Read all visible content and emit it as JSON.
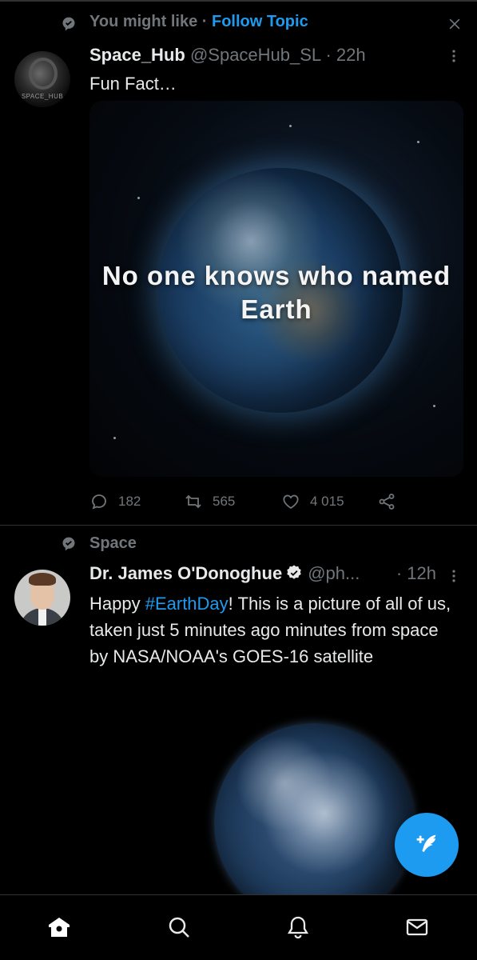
{
  "tweet1": {
    "context_label": "You might like",
    "context_separator": " · ",
    "follow_topic": "Follow Topic",
    "avatar_label": "SPACE_HUB",
    "name": "Space_Hub",
    "handle": "@SpaceHub_SL",
    "time": " · 22h",
    "text": "Fun Fact…",
    "media_text": "No one knows who named Earth",
    "replies": "182",
    "retweets": "565",
    "likes": "4 015"
  },
  "tweet2": {
    "topic": "Space",
    "name": "Dr. James O'Donoghue",
    "handle": "@ph...",
    "time": "· 12h",
    "text_before": "Happy ",
    "hashtag": "#EarthDay",
    "text_after": "! This is a picture of all of us, taken just 5 minutes ago minutes from space by NASA/NOAA's GOES-16 satellite"
  },
  "icons": {
    "context": "topic-bubble-icon",
    "close": "close-icon",
    "more": "more-vertical-icon",
    "reply": "reply-icon",
    "retweet": "retweet-icon",
    "like": "heart-icon",
    "share": "share-icon",
    "verified": "verified-badge-icon",
    "compose": "compose-tweet-icon",
    "home": "home-icon",
    "search": "search-icon",
    "notifications": "bell-icon",
    "messages": "mail-icon"
  },
  "colors": {
    "background": "#000000",
    "accent": "#1d9bf0",
    "muted": "#71767b",
    "text": "#e7e9ea"
  }
}
